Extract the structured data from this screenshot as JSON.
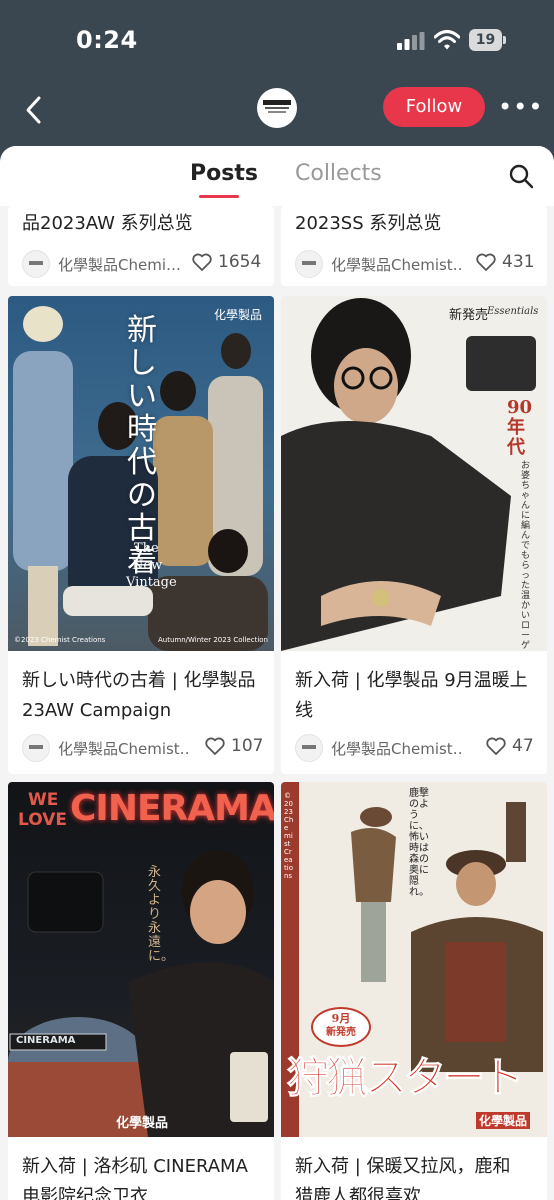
{
  "status_bar": {
    "time": "0:24",
    "battery": "19"
  },
  "nav": {
    "follow_label": "Follow",
    "more_label": "•••"
  },
  "tabs": {
    "posts": "Posts",
    "collects": "Collects"
  },
  "posts": [
    {
      "title": "品2023AW 系列总览",
      "author": "化學製品Chemi…",
      "likes": "1654"
    },
    {
      "title": "2023SS 系列总览",
      "author": "化學製品Chemist…",
      "likes": "431"
    },
    {
      "title_line1": "新しい時代の古着 | 化學製品",
      "title_line2": "23AW Campaign",
      "author": "化學製品Chemist…",
      "likes": "107",
      "image": {
        "brand": "化學製品",
        "headline": "新しい時代の古着",
        "en1": "The",
        "en2": "New",
        "en3": "Vintage",
        "foot_left": "©2023 Chemist Creations",
        "foot_right": "Autumn/Winter 2023 Collection"
      }
    },
    {
      "title_line1": "新入荷 | 化學製品 9月温暖上",
      "title_line2": "线",
      "author": "化學製品Chemist…",
      "likes": "47",
      "image": {
        "badge": "新発売",
        "essentials": "Essentials",
        "decade": "90年代",
        "tagline": "お婆ちゃんに編んでもらった温かいローゲージ"
      }
    },
    {
      "title_line1": "新入荷 | 洛杉矶 CINERAMA",
      "title_line2": "电影院纪念卫衣",
      "image": {
        "we": "WE",
        "love": "LOVE",
        "cinerama": "CINERAMA",
        "tagline": "永久より永遠に。",
        "sign": "CINERAMA",
        "brand": "化學製品"
      }
    },
    {
      "title_line1": "新入荷 | 保暖又拉风，鹿和",
      "title_line2": "猎鹿人都很喜欢",
      "image": {
        "month": "9月",
        "new": "新発売",
        "headline": "狩猟スタート",
        "brand": "化學製品",
        "tagline": "鹿撃のように、怖い時は森の奥に隠れ。",
        "credit": "©2023 Chemist Creations"
      }
    }
  ]
}
